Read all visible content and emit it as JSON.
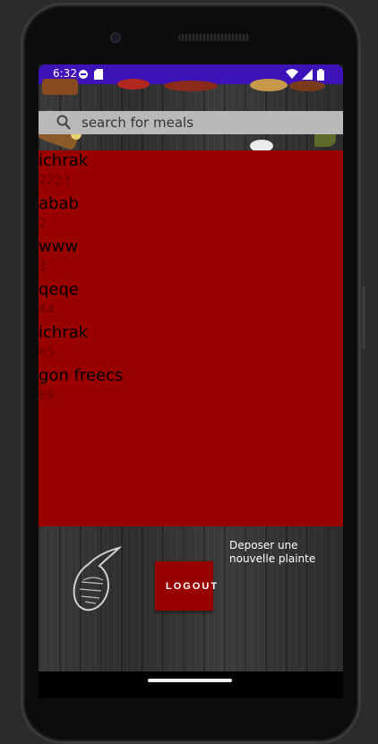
{
  "status": {
    "time": "6:32",
    "icons": [
      "notification-icon",
      "sim-icon",
      "wifi-icon",
      "signal-icon",
      "battery-icon"
    ]
  },
  "search": {
    "placeholder": "search for meals"
  },
  "meals": [
    {
      "name": "ichrak",
      "price": "2223"
    },
    {
      "name": "abab",
      "price": "2"
    },
    {
      "name": "www",
      "price": "3"
    },
    {
      "name": "qeqe",
      "price": "44"
    },
    {
      "name": "ichrak",
      "price": "65"
    },
    {
      "name": "gon freecs",
      "price": "89"
    }
  ],
  "footer": {
    "logout_label": "LOGOUT",
    "deposer_label": "Deposer une nouvelle plainte"
  },
  "colors": {
    "status_bar": "#3d12b8",
    "list_bg": "#990000",
    "logout_bg": "#990000"
  }
}
